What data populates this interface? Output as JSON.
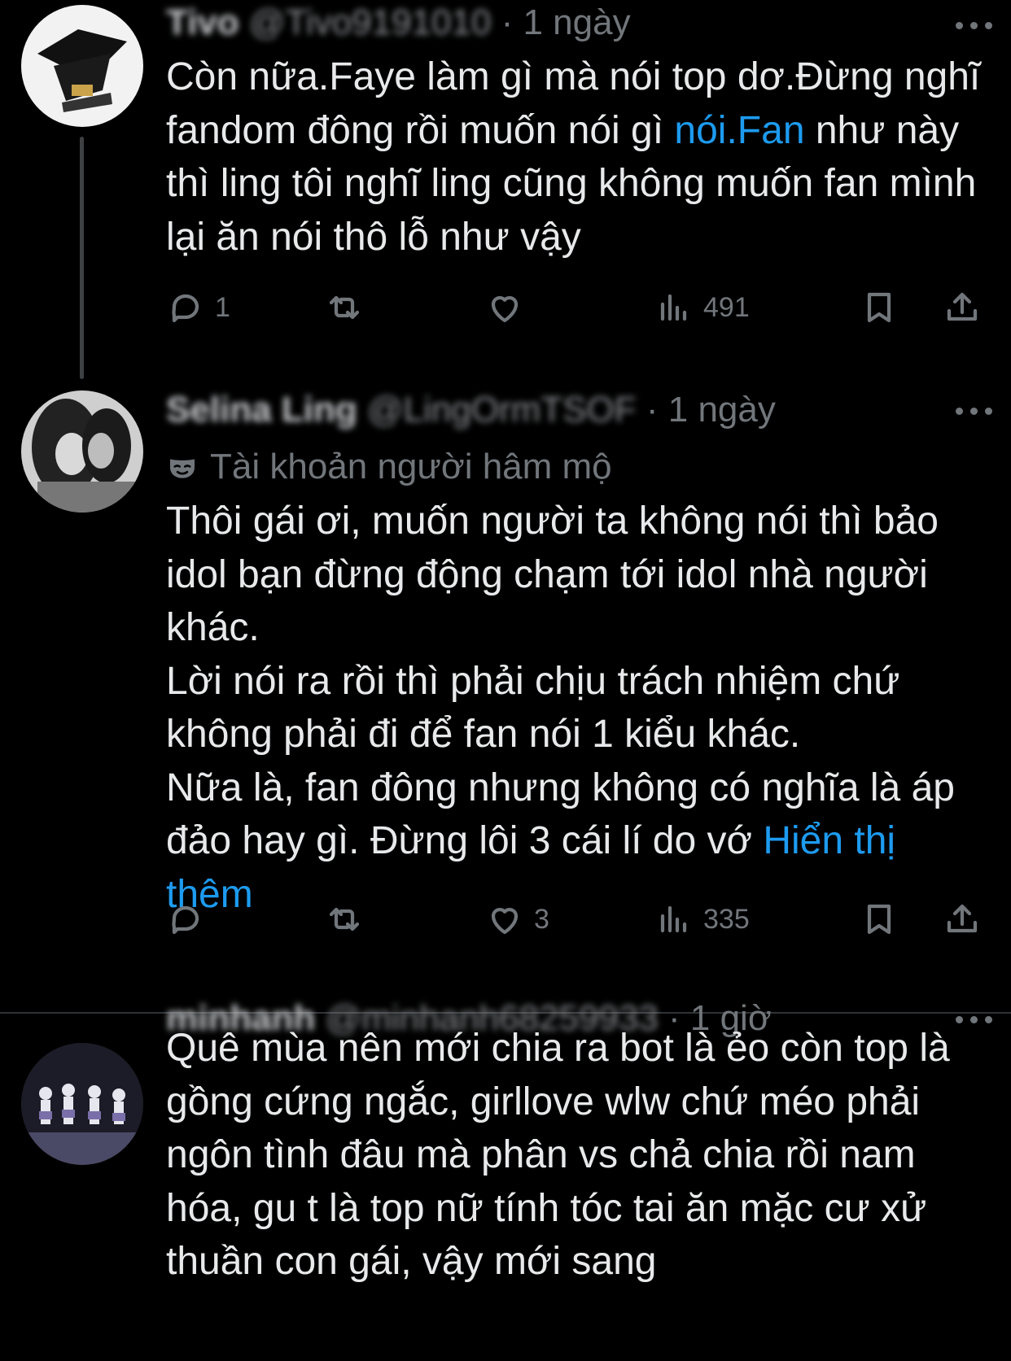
{
  "tweets": [
    {
      "display_name": "Tivo",
      "handle": "@Tivo9191010",
      "time": "· 1 ngày",
      "fan_label": "",
      "body_lines": [
        [
          "Còn nữa.Faye làm gì mà nói top dơ.Đừng nghĩ fandom đông rồi muốn nói gì ",
          "nói.Fan",
          " như này thì ling tôi nghĩ ling cũng không muốn fan mình lại ăn nói thô lỗ như vậy"
        ]
      ],
      "actions": {
        "reply": "1",
        "retweet": "",
        "like": "",
        "views": "491"
      }
    },
    {
      "display_name": "Selina Ling",
      "handle": "@LingOrmTSOF",
      "time": "· 1 ngày",
      "fan_label": "Tài khoản người hâm mộ",
      "body_lines": [
        "Thôi gái ơi, muốn người ta không nói thì bảo idol bạn đừng động chạm tới idol nhà người khác.",
        "Lời nói ra rồi thì phải chịu trách nhiệm chứ không phải đi để fan nói 1 kiểu khác.",
        "Nữa là, fan đông nhưng không có nghĩa là áp đảo hay gì. Đừng lôi 3 cái lí do vớ"
      ],
      "show_more": "Hiển thị thêm",
      "actions": {
        "reply": "",
        "retweet": "",
        "like": "3",
        "views": "335"
      }
    },
    {
      "display_name": "minhanh",
      "handle": "@minhanh68259933",
      "time": "· 1 giờ",
      "fan_label": "",
      "body_lines": [
        "Quê mùa nên mới chia ra bot là ẻo còn top là gồng cứng ngắc, girllove wlw chứ méo phải ngôn tình đâu mà phân vs chả chia rồi nam hóa, gu t là top nữ tính tóc tai ăn mặc cư xử thuần con gái, vậy mới sang"
      ]
    }
  ]
}
